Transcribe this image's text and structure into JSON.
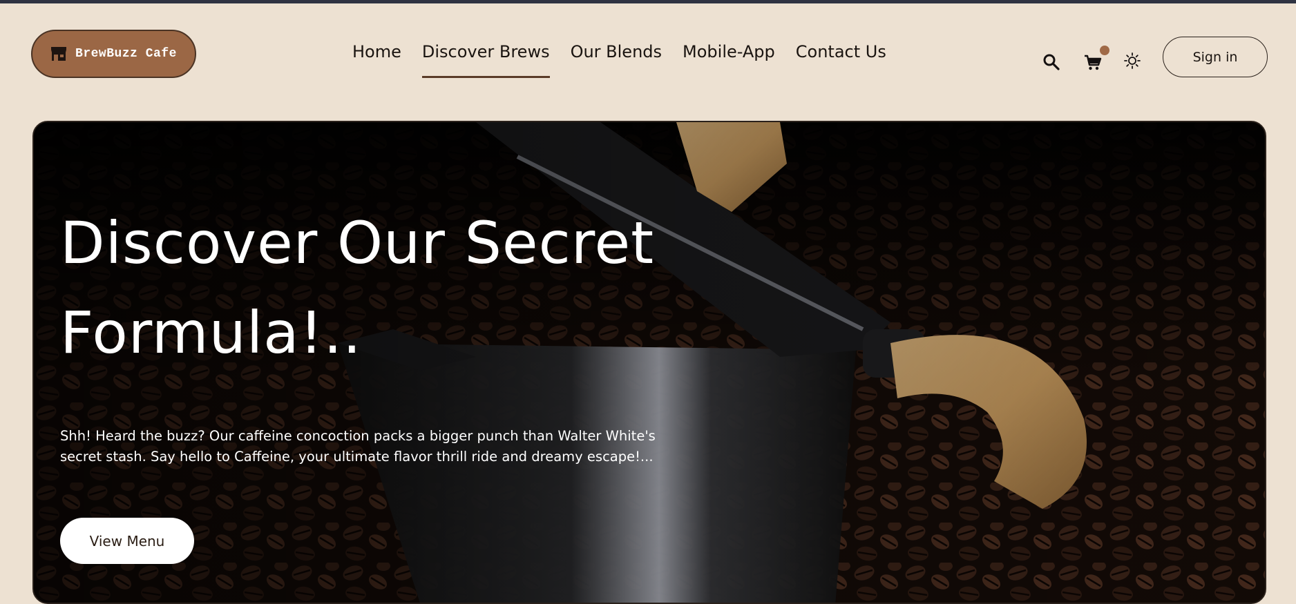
{
  "brand": {
    "name": "BrewBuzz Cafe",
    "icon": "store-icon"
  },
  "nav": {
    "items": [
      {
        "label": "Home",
        "active": false
      },
      {
        "label": "Discover Brews",
        "active": true
      },
      {
        "label": "Our Blends",
        "active": false
      },
      {
        "label": "Mobile-App",
        "active": false
      },
      {
        "label": "Contact Us",
        "active": false
      }
    ]
  },
  "toolbar": {
    "search_icon": "search-icon",
    "cart_icon": "cart-icon",
    "theme_icon": "sun-icon",
    "signin_label": "Sign in"
  },
  "hero": {
    "title_line1": "Discover Our Secret",
    "title_line2": "Formula!..",
    "description": "Shh! Heard the buzz? Our caffeine concoction packs a bigger punch than Walter White's secret stash. Say hello to Caffeine, your ultimate flavor thrill ride and dreamy escape!...",
    "cta_label": "View Menu"
  },
  "colors": {
    "background": "#ede1d2",
    "brand": "#9b6745",
    "accent_underline": "#5a3b27",
    "cart_badge": "#a06a47",
    "top_strip": "#2f3342"
  }
}
